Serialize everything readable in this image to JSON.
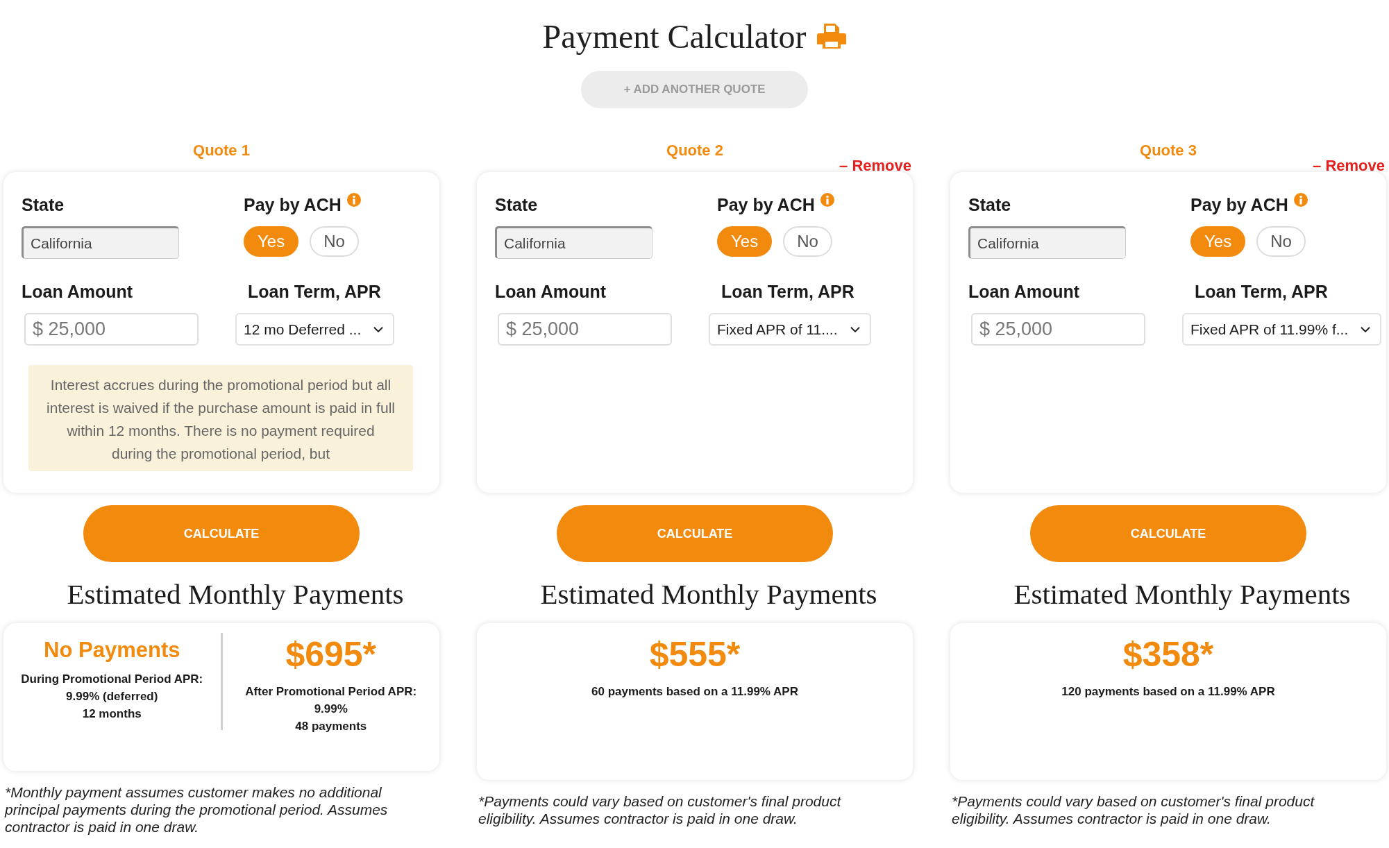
{
  "title": "Payment Calculator",
  "add_quote_button": {
    "label": "+ ADD ANOTHER QUOTE",
    "disabled": true
  },
  "quotes": [
    {
      "heading": "Quote 1",
      "state": {
        "label": "State",
        "value": "California"
      },
      "ach": {
        "label": "Pay by ACH",
        "options": [
          {
            "label": "Yes",
            "selected": true
          },
          {
            "label": "No",
            "selected": false
          }
        ]
      },
      "loan_amount": {
        "label": "Loan Amount",
        "placeholder": "$ 25,000"
      },
      "loan_term": {
        "label": "Loan Term, APR",
        "value": "12 mo Deferred ..."
      },
      "note": "Interest accrues during the promotional period but all interest is waived if the purchase amount is paid in full within 12 months. There is no payment required during the promotional period, but",
      "calculate_button": "CALCULATE",
      "results_heading": "Estimated Monthly Payments",
      "results": [
        {
          "kind": "text",
          "headline": "No Payments",
          "lines": [
            "During Promotional Period APR:",
            "9.99% (deferred)",
            "12 months"
          ]
        },
        {
          "kind": "amount",
          "headline": "$695*",
          "lines": [
            "After Promotional Period APR:",
            "9.99%",
            "48 payments"
          ]
        }
      ],
      "footnote": "*Monthly payment assumes customer makes no additional principal payments during the promotional period. Assumes contractor is paid in one draw."
    },
    {
      "heading": "Quote 2",
      "remove_link": "– Remove",
      "state": {
        "label": "State",
        "value": "California"
      },
      "ach": {
        "label": "Pay by ACH",
        "options": [
          {
            "label": "Yes",
            "selected": true
          },
          {
            "label": "No",
            "selected": false
          }
        ]
      },
      "loan_amount": {
        "label": "Loan Amount",
        "placeholder": "$ 25,000"
      },
      "loan_term": {
        "label": "Loan Term, APR",
        "value": "Fixed APR of 11...."
      },
      "calculate_button": "CALCULATE",
      "results_heading": "Estimated Monthly Payments",
      "results": [
        {
          "kind": "amount",
          "headline": "$555*",
          "lines": [
            "60 payments based on a 11.99% APR"
          ]
        }
      ],
      "footnote": "*Payments could vary based on customer's final product eligibility. Assumes contractor is paid in one draw."
    },
    {
      "heading": "Quote 3",
      "remove_link": "– Remove",
      "state": {
        "label": "State",
        "value": "California"
      },
      "ach": {
        "label": "Pay by ACH",
        "options": [
          {
            "label": "Yes",
            "selected": true
          },
          {
            "label": "No",
            "selected": false
          }
        ]
      },
      "loan_amount": {
        "label": "Loan Amount",
        "placeholder": "$ 25,000"
      },
      "loan_term": {
        "label": "Loan Term, APR",
        "value": "Fixed APR of 11.99% f..."
      },
      "calculate_button": "CALCULATE",
      "results_heading": "Estimated Monthly Payments",
      "results": [
        {
          "kind": "amount",
          "headline": "$358*",
          "lines": [
            "120 payments based on a 11.99% APR"
          ]
        }
      ],
      "footnote": "*Payments could vary based on customer's final product eligibility. Assumes contractor is paid in one draw."
    }
  ]
}
